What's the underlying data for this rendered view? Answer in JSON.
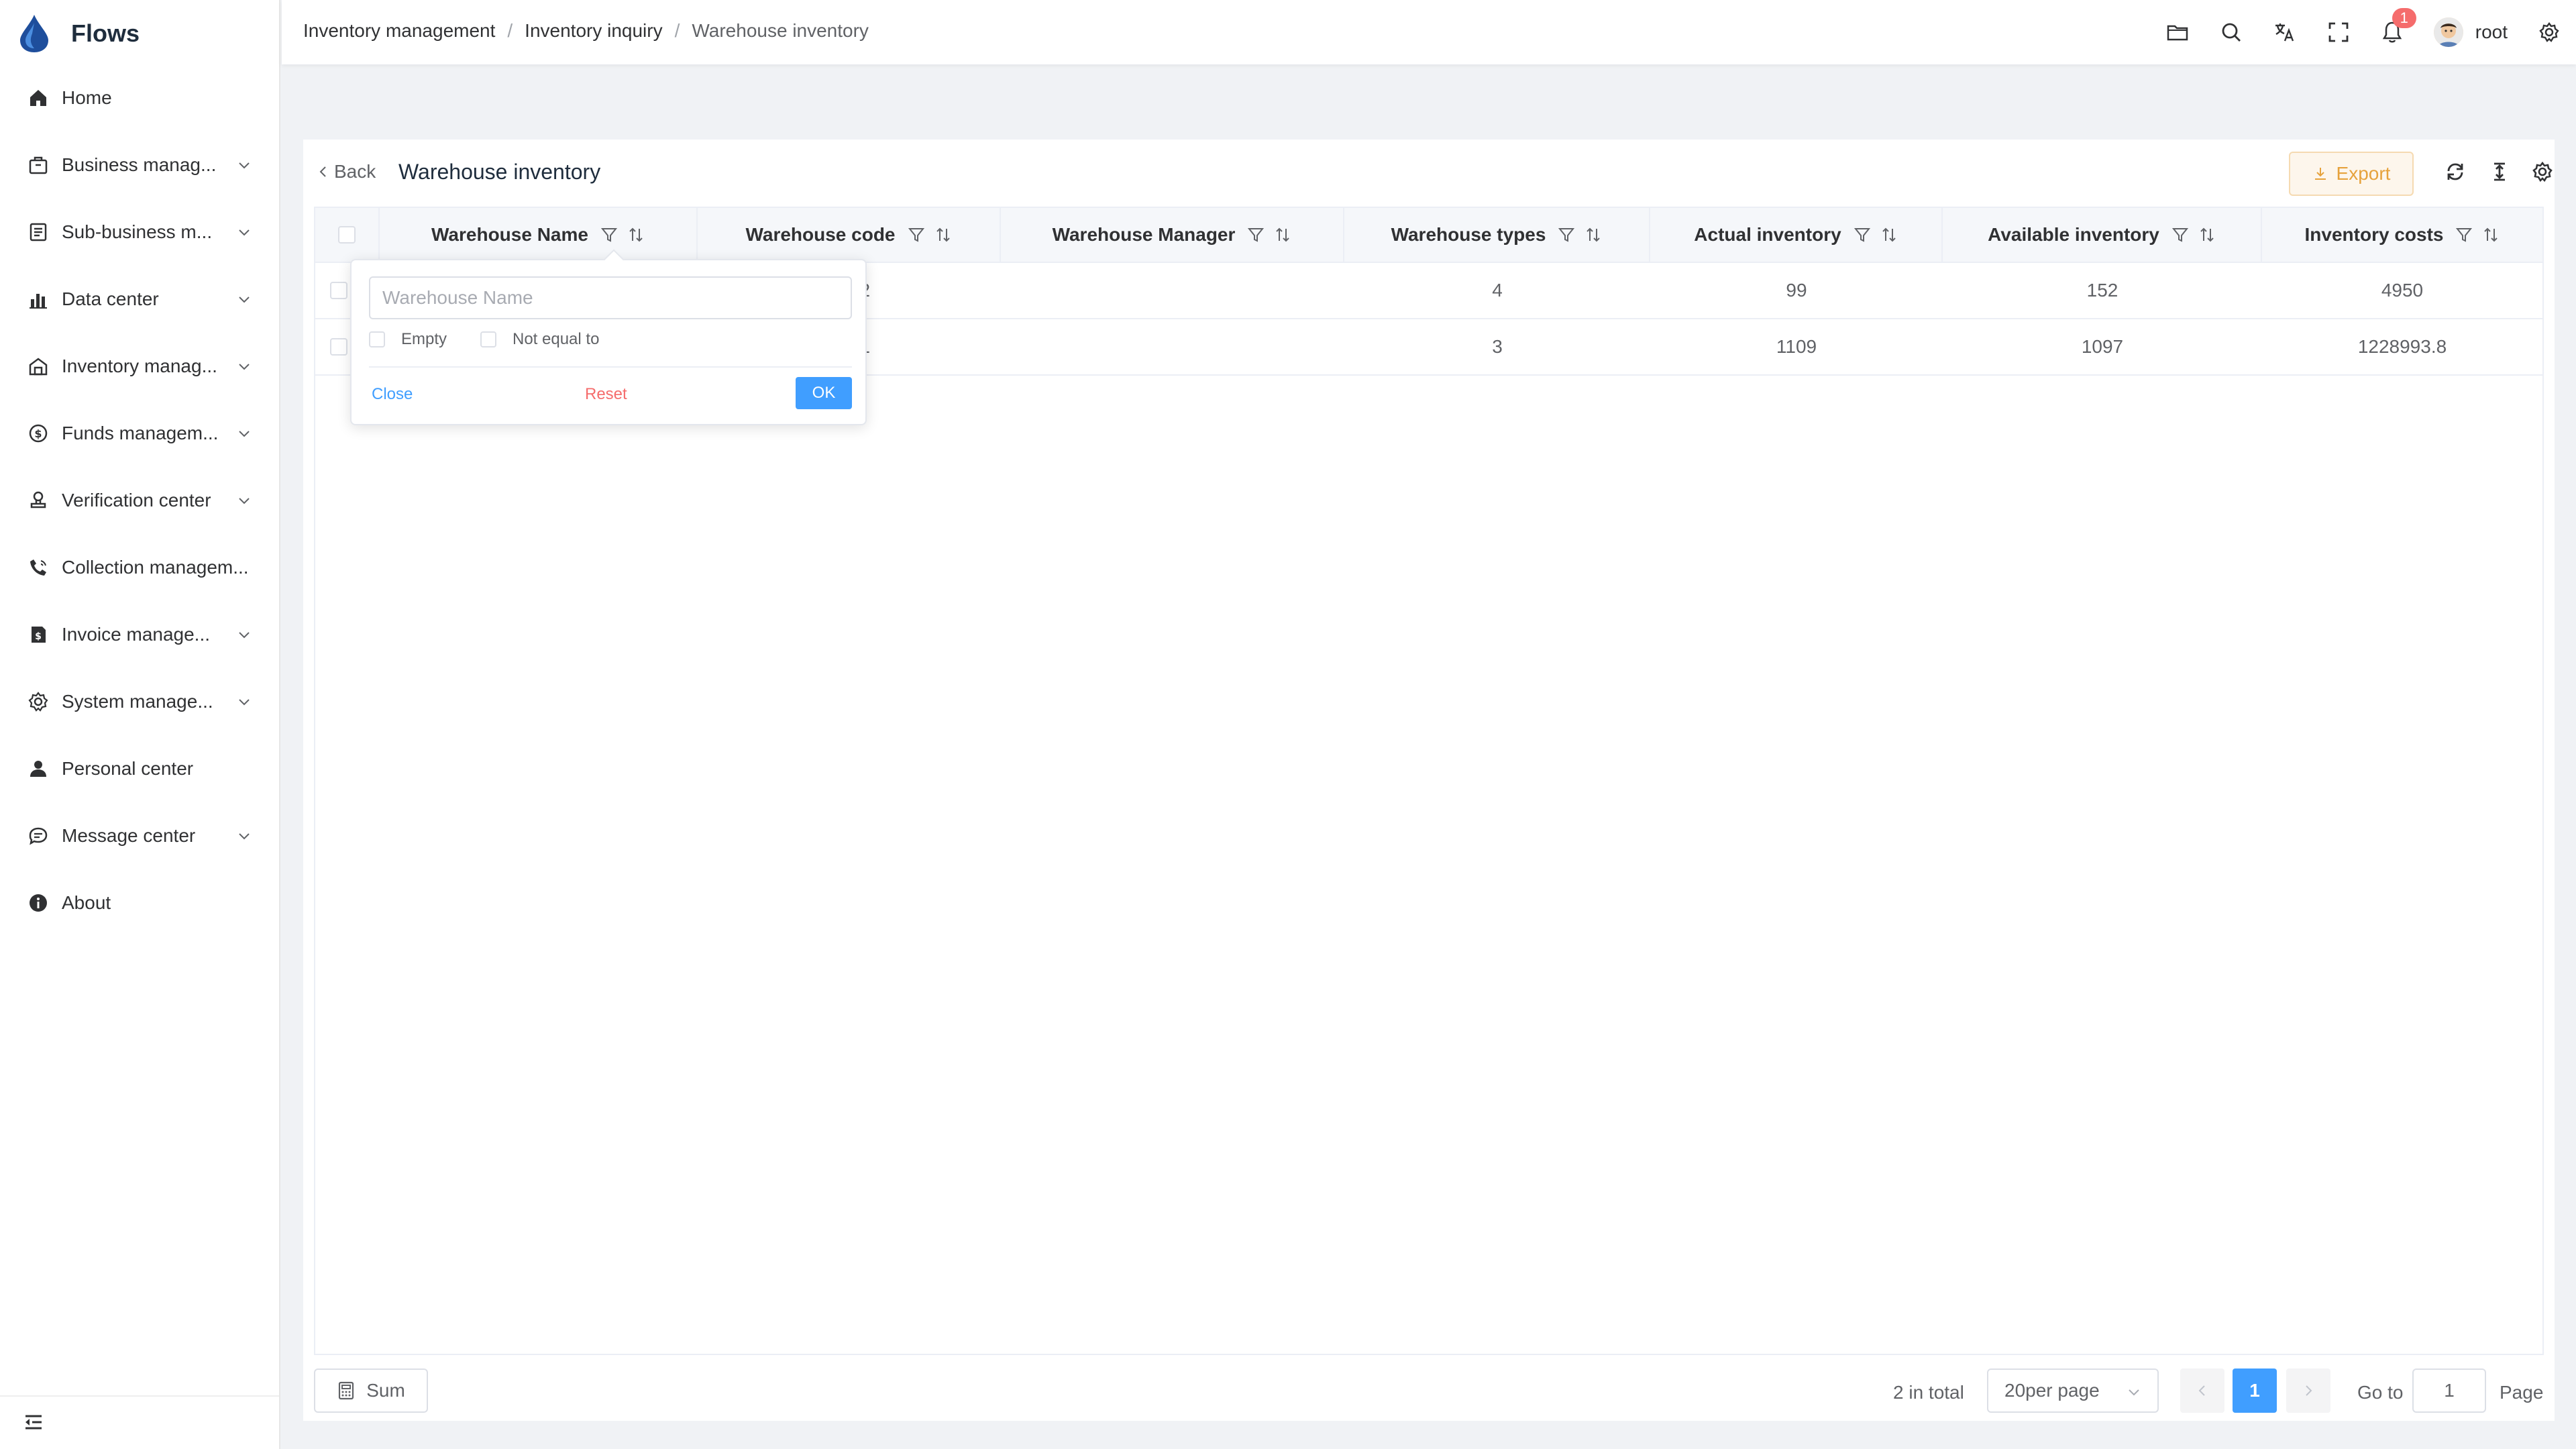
{
  "app": {
    "name": "Flows"
  },
  "sidebar": {
    "items": [
      {
        "label": "Home",
        "icon": "home-icon",
        "expandable": false
      },
      {
        "label": "Business manag...",
        "icon": "briefcase-icon",
        "expandable": true
      },
      {
        "label": "Sub-business m...",
        "icon": "document-icon",
        "expandable": true
      },
      {
        "label": "Data center",
        "icon": "bar-chart-icon",
        "expandable": true
      },
      {
        "label": "Inventory manag...",
        "icon": "warehouse-icon",
        "expandable": true
      },
      {
        "label": "Funds managem...",
        "icon": "coin-icon",
        "expandable": true
      },
      {
        "label": "Verification center",
        "icon": "stamp-icon",
        "expandable": true
      },
      {
        "label": "Collection managem...",
        "icon": "phone-icon",
        "expandable": false
      },
      {
        "label": "Invoice manage...",
        "icon": "invoice-icon",
        "expandable": true
      },
      {
        "label": "System manage...",
        "icon": "gear-icon",
        "expandable": true
      },
      {
        "label": "Personal center",
        "icon": "user-icon",
        "expandable": false
      },
      {
        "label": "Message center",
        "icon": "chat-icon",
        "expandable": true
      },
      {
        "label": "About",
        "icon": "info-icon",
        "expandable": false
      }
    ]
  },
  "header": {
    "breadcrumb": [
      "Inventory management",
      "Inventory inquiry",
      "Warehouse inventory"
    ],
    "notification_count": "1",
    "user": "root"
  },
  "page": {
    "back_label": "Back",
    "title": "Warehouse inventory",
    "export_label": "Export"
  },
  "table": {
    "columns": [
      "Warehouse Name",
      "Warehouse code",
      "Warehouse Manager",
      "Warehouse types",
      "Actual inventory",
      "Available inventory",
      "Inventory costs"
    ],
    "rows": [
      {
        "warehouse_name": "",
        "warehouse_code": "8122",
        "warehouse_manager": "",
        "warehouse_types": "4",
        "actual_inventory": "99",
        "available_inventory": "152",
        "inventory_costs": "4950"
      },
      {
        "warehouse_name": "",
        "warehouse_code": "7121",
        "warehouse_manager": "",
        "warehouse_types": "3",
        "actual_inventory": "1109",
        "available_inventory": "1097",
        "inventory_costs": "1228993.8"
      }
    ]
  },
  "filter_popover": {
    "input_placeholder": "Warehouse Name",
    "option_empty": "Empty",
    "option_not_equal": "Not equal to",
    "close_label": "Close",
    "reset_label": "Reset",
    "ok_label": "OK"
  },
  "footer": {
    "sum_label": "Sum",
    "total_text": "2 in total",
    "page_size_text": "20per page",
    "current_page": "1",
    "goto_label": "Go to",
    "goto_value": "1",
    "page_label": "Page"
  },
  "colors": {
    "primary": "#409eff",
    "danger": "#f56c6c",
    "warning": "#e6a23c",
    "background": "#f0f2f5"
  }
}
